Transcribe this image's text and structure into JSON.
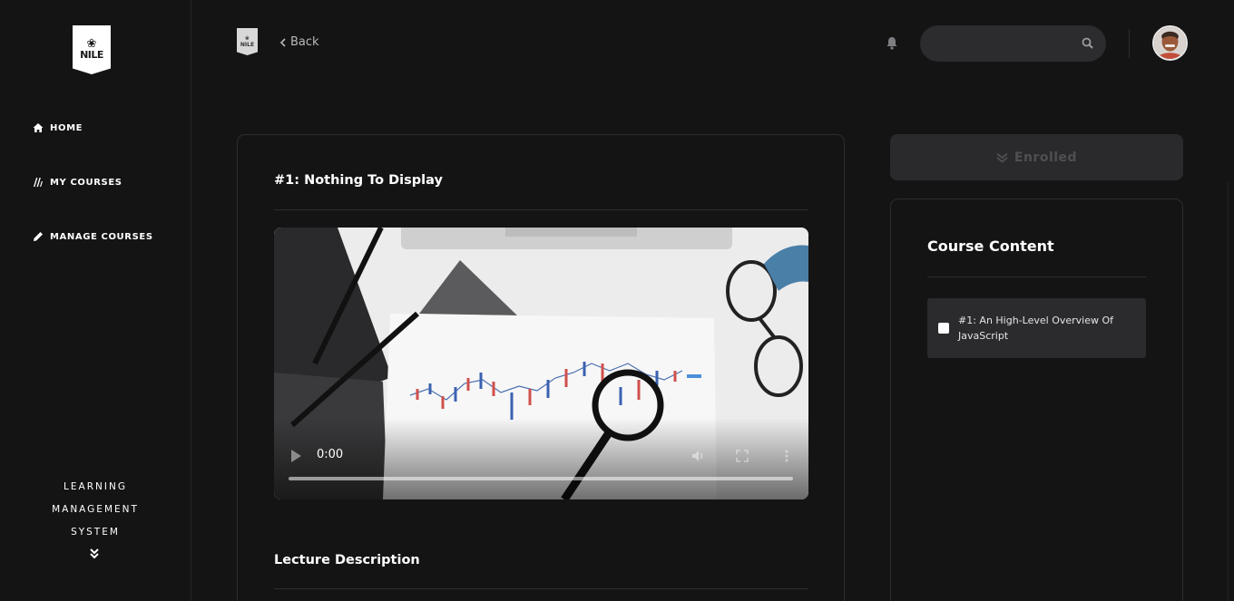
{
  "brand": {
    "logo_text": "NILE",
    "small_logo_text": "NILE"
  },
  "sidebar": {
    "items": [
      {
        "label": "HOME",
        "icon": "home-icon"
      },
      {
        "label": "MY COURSES",
        "icon": "books-icon"
      },
      {
        "label": "MANAGE COURSES",
        "icon": "pencil-icon"
      }
    ],
    "footer_lines": [
      "LEARNING",
      "MANAGEMENT",
      "SYSTEM"
    ]
  },
  "header": {
    "back_label": "Back",
    "search_placeholder": ""
  },
  "lecture": {
    "title": "#1: Nothing To Display",
    "video": {
      "time": "0:00",
      "progress": 0
    },
    "description_heading": "Lecture Description"
  },
  "enroll": {
    "label": "Enrolled"
  },
  "course_content": {
    "heading": "Course Content",
    "items": [
      {
        "label": "#1: An High-Level Overview Of JavaScript",
        "checked": false
      }
    ]
  },
  "colors": {
    "background": "#141415",
    "card_border": "#2d2d31",
    "button_bg": "#2a2a2c",
    "muted_text": "#4f4f53"
  }
}
